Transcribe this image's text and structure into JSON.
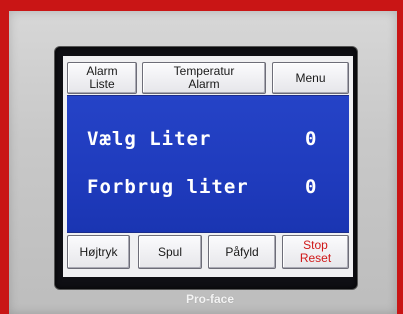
{
  "top_buttons": {
    "alarm_list": [
      "Alarm",
      "Liste"
    ],
    "temperature_alarm": [
      "Temperatur",
      "Alarm"
    ],
    "menu": "Menu"
  },
  "readouts": [
    {
      "label": "Vælg Liter",
      "value": "0"
    },
    {
      "label": "Forbrug liter",
      "value": "0"
    }
  ],
  "bottom_buttons": {
    "high_pressure": "Højtryk",
    "flush": "Spul",
    "fill": "Påfyld",
    "stop_reset": [
      "Stop",
      "Reset"
    ]
  },
  "brand": "Pro-face",
  "colors": {
    "enclosure": "#c91515",
    "display_bg": "#2543c7",
    "stop_text": "#d01919"
  }
}
